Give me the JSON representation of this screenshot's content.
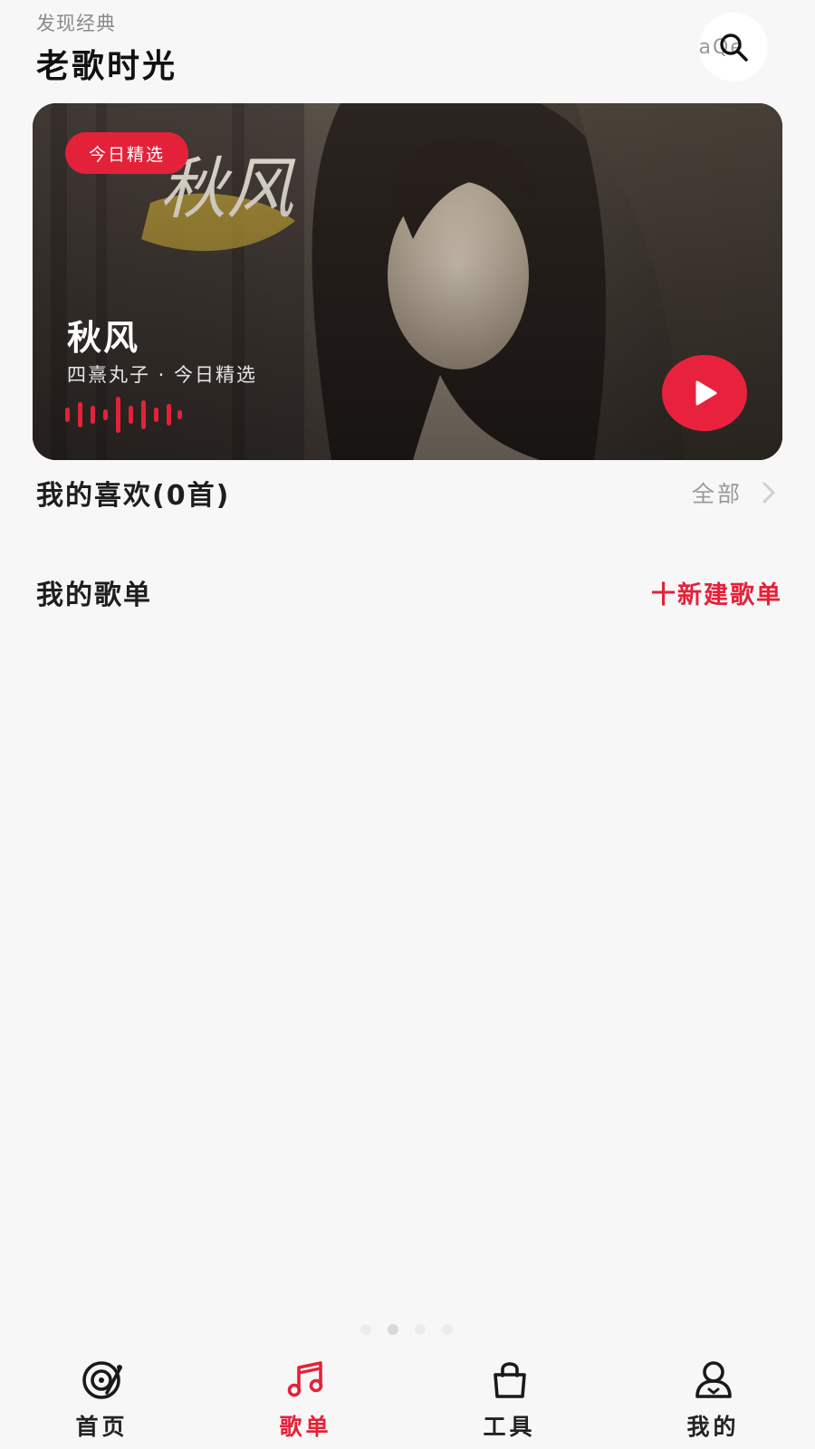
{
  "header": {
    "subtitle": "发现经典",
    "title": "老歌时光",
    "search_ghost_text": "eaQe"
  },
  "banner": {
    "tag": "今日精选",
    "song_title": "秋风",
    "meta": "四熹丸子 · 今日精选",
    "cover_text": "秋风",
    "accent_color": "#e3223a"
  },
  "favorites": {
    "title": "我的喜欢(0首)",
    "view_all_label": "全部"
  },
  "playlists": {
    "title": "我的歌单",
    "new_label": "十新建歌单"
  },
  "page_indicator": {
    "count": 4,
    "active": 1
  },
  "tabbar": {
    "items": [
      {
        "label": "首页",
        "icon": "disc-icon",
        "active": false
      },
      {
        "label": "歌单",
        "icon": "music-note-icon",
        "active": true
      },
      {
        "label": "工具",
        "icon": "bag-icon",
        "active": false
      },
      {
        "label": "我的",
        "icon": "user-icon",
        "active": false
      }
    ]
  },
  "colors": {
    "accent": "#e3223a",
    "background": "#f7f7f8",
    "text": "#1e1e1e",
    "muted": "#9a9a9a"
  }
}
